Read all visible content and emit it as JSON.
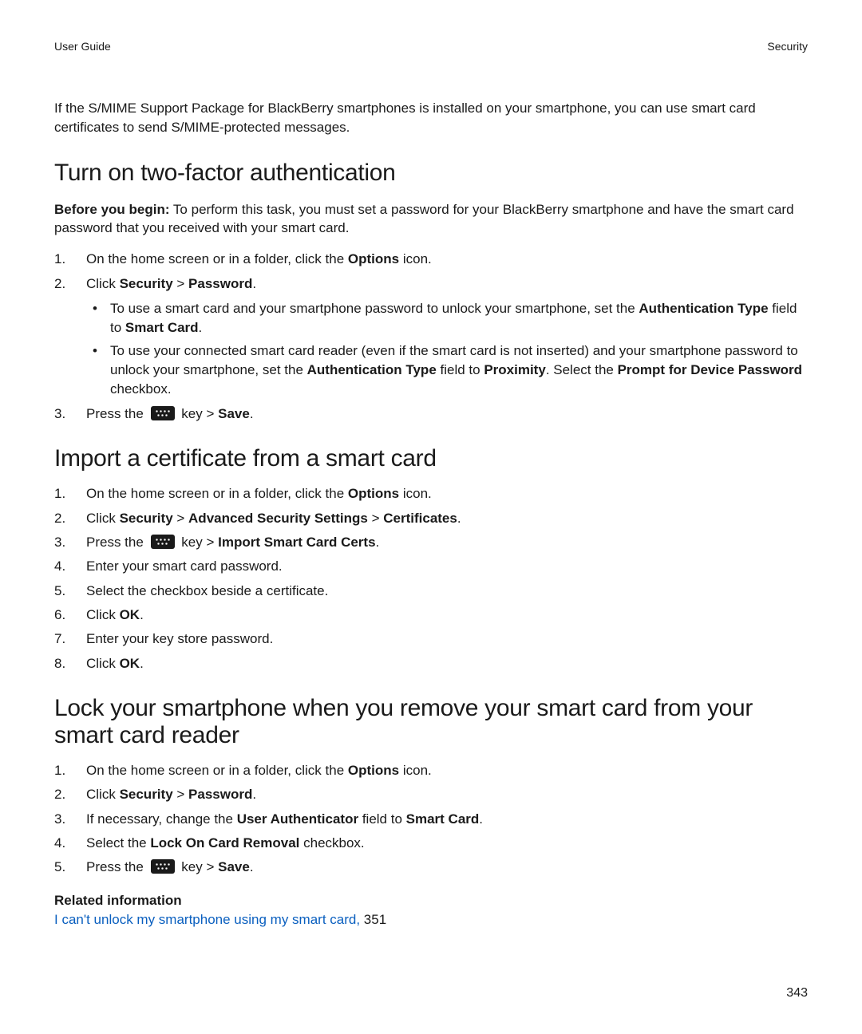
{
  "header": {
    "left": "User Guide",
    "right": "Security"
  },
  "intro": "If the S/MIME Support Package for BlackBerry smartphones is installed on your smartphone, you can use smart card certificates to send S/MIME-protected messages.",
  "section1": {
    "title": "Turn on two-factor authentication",
    "before_label": "Before you begin:",
    "before_text": " To perform this task, you must set a password for your BlackBerry smartphone and have the smart card password that you received with your smart card.",
    "step1_a": "On the home screen or in a folder, click the ",
    "step1_b": "Options",
    "step1_c": " icon.",
    "step2_a": "Click ",
    "step2_b": "Security",
    "step2_c": " > ",
    "step2_d": "Password",
    "step2_e": ".",
    "bullet1_a": "To use a smart card and your smartphone password to unlock your smartphone, set the ",
    "bullet1_b": "Authentication Type",
    "bullet1_c": " field to ",
    "bullet1_d": "Smart Card",
    "bullet1_e": ".",
    "bullet2_a": "To use your connected smart card reader (even if the smart card is not inserted) and your smartphone password to unlock your smartphone, set the ",
    "bullet2_b": "Authentication Type",
    "bullet2_c": " field to ",
    "bullet2_d": "Proximity",
    "bullet2_e": ". Select the ",
    "bullet2_f": "Prompt for Device Password",
    "bullet2_g": " checkbox.",
    "step3_a": "Press the ",
    "step3_b": " key > ",
    "step3_c": "Save",
    "step3_d": "."
  },
  "section2": {
    "title": "Import a certificate from a smart card",
    "s1_a": "On the home screen or in a folder, click the ",
    "s1_b": "Options",
    "s1_c": " icon.",
    "s2_a": "Click ",
    "s2_b": "Security",
    "s2_c": " > ",
    "s2_d": "Advanced Security Settings",
    "s2_e": " > ",
    "s2_f": "Certificates",
    "s2_g": ".",
    "s3_a": "Press the ",
    "s3_b": " key > ",
    "s3_c": "Import Smart Card Certs",
    "s3_d": ".",
    "s4": "Enter your smart card password.",
    "s5": "Select the checkbox beside a certificate.",
    "s6_a": "Click ",
    "s6_b": "OK",
    "s6_c": ".",
    "s7": "Enter your key store password.",
    "s8_a": "Click ",
    "s8_b": "OK",
    "s8_c": "."
  },
  "section3": {
    "title": "Lock your smartphone when you remove your smart card from your smart card reader",
    "s1_a": "On the home screen or in a folder, click the ",
    "s1_b": "Options",
    "s1_c": " icon.",
    "s2_a": "Click ",
    "s2_b": "Security",
    "s2_c": " > ",
    "s2_d": "Password",
    "s2_e": ".",
    "s3_a": "If necessary, change the ",
    "s3_b": "User Authenticator",
    "s3_c": " field to ",
    "s3_d": "Smart Card",
    "s3_e": ".",
    "s4_a": "Select the ",
    "s4_b": "Lock On Card Removal",
    "s4_c": " checkbox.",
    "s5_a": "Press the ",
    "s5_b": " key > ",
    "s5_c": "Save",
    "s5_d": "."
  },
  "related": {
    "heading": "Related information",
    "link_text": "I can't unlock my smartphone using my smart card,",
    "link_suffix": " 351"
  },
  "page_number": "343"
}
